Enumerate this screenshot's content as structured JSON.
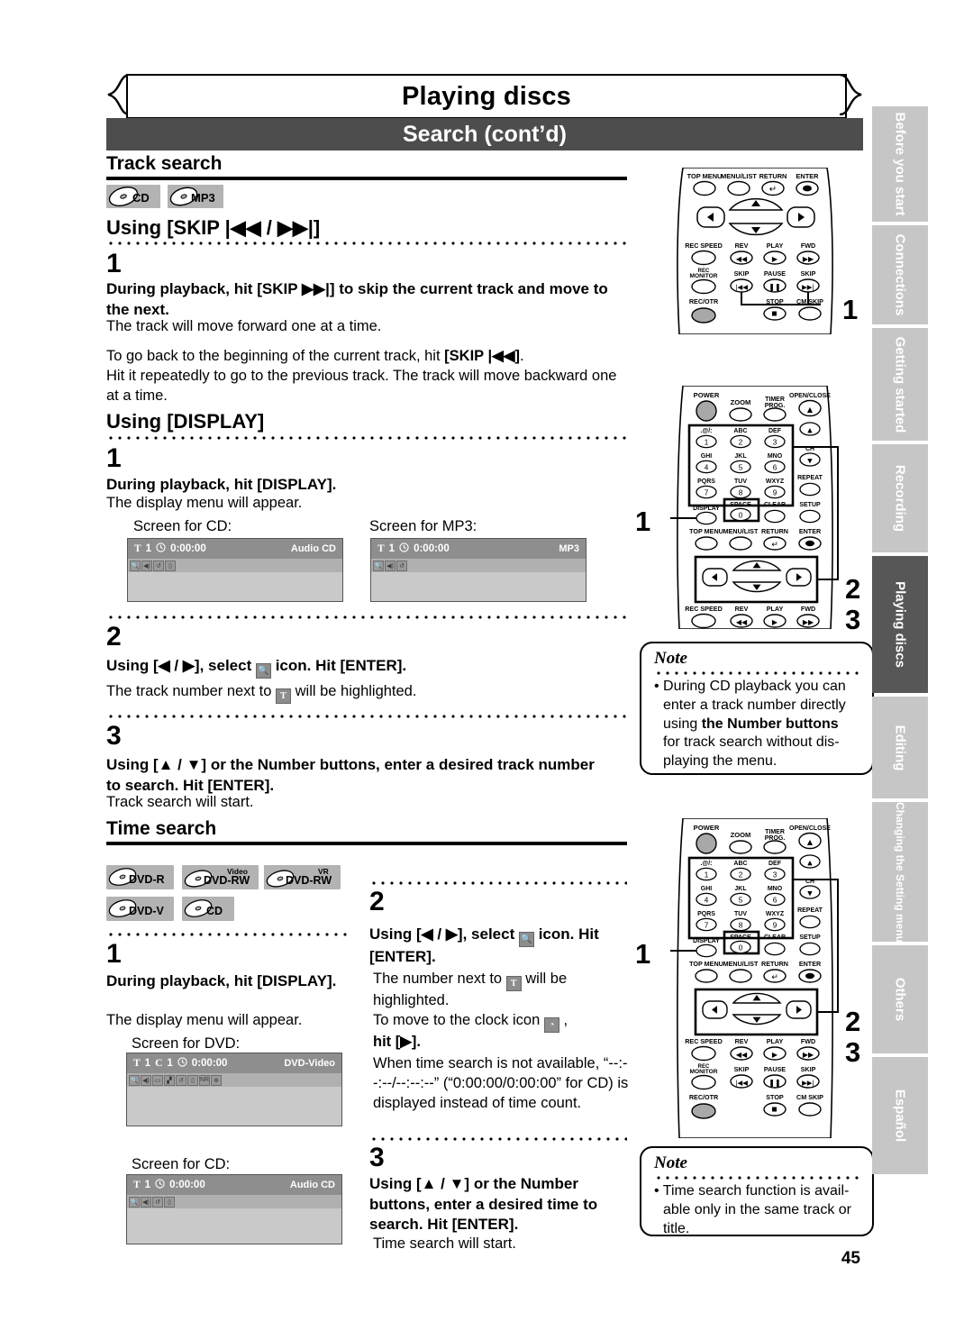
{
  "header": {
    "title": "Playing discs",
    "subtitle": "Search (cont’d)"
  },
  "page_number": "45",
  "sections": {
    "track_search": {
      "heading": "Track search",
      "badges": [
        "CD",
        "MP3"
      ],
      "skip_sub": "Using [SKIP |◀◀ / ▶▶|]",
      "skip_step1_num": "1",
      "skip_step1_bold": "During playback, hit [SKIP ▶▶|] to skip the current track and move to the next.",
      "skip_step1_text": "The track will move forward one at a time.",
      "skip_step1_text2a": "To go back to the beginning of the current track, hit ",
      "skip_step1_text2b": "[SKIP |◀◀]",
      "skip_step1_text2c": ".",
      "skip_step1_text3": "Hit it repeatedly to go to the previous track. The track will move backward one at a time.",
      "display_sub": "Using [DISPLAY]",
      "d_step1_num": "1",
      "d_step1_bold": "During playback, hit [DISPLAY].",
      "d_step1_text": "The display menu will appear.",
      "screen_cd_label": "Screen for CD:",
      "screen_mp3_label": "Screen for MP3:",
      "d_step2_num": "2",
      "d_step2_bold_a": "Using [◀ / ▶], select",
      "d_step2_bold_b": "icon. Hit [ENTER].",
      "d_step2_text_a": "The track number next to",
      "d_step2_text_b": "will be highlighted.",
      "d_step3_num": "3",
      "d_step3_bold": "Using [▲ / ▼] or the Number buttons, enter a desired track number to search. Hit [ENTER].",
      "d_step3_text": "Track search will start."
    },
    "time_search": {
      "heading": "Time search",
      "badges": [
        "DVD-R",
        "DVD-RW",
        "DVD-RW",
        "DVD-V",
        "CD"
      ],
      "badge_tags": [
        "",
        "Video",
        "VR",
        "",
        ""
      ],
      "step1_num": "1",
      "step1_bold": "During playback, hit [DISPLAY].",
      "step1_text": "The display menu will appear.",
      "screen_dvd_label": "Screen for DVD:",
      "screen_cd_label": "Screen for CD:",
      "step2_num": "2",
      "step2_bold_a": "Using [◀ / ▶], select",
      "step2_bold_b": "icon. Hit [ENTER].",
      "step2_t1a": "The number next to",
      "step2_t1b": "will be",
      "step2_t1c": "highlighted.",
      "step2_t2a": "To move to the clock icon",
      "step2_t2b": ",",
      "step2_t2c": "hit [▶].",
      "step2_t3": "When time search is not available, “--:--:--/--:--:--” (“0:00:00/0:00:00” for CD) is displayed instead of time count.",
      "step3_num": "3",
      "step3_bold": "Using [▲ / ▼] or the Number buttons, enter a desired time to search. Hit [ENTER].",
      "step3_text": "Time search will start."
    }
  },
  "osd_screens": {
    "cd_top": {
      "title_glyph": "T",
      "title_num": "1",
      "clock_glyph": "clock-icon",
      "time": "0:00:00",
      "disc_label": "Audio CD",
      "icon_count": 4
    },
    "mp3_top": {
      "title_glyph": "T",
      "title_num": "1",
      "clock_glyph": "clock-icon",
      "time": "0:00:00",
      "disc_label": "MP3",
      "icon_count": 3
    },
    "dvd": {
      "title_glyph": "T",
      "title_num": "1",
      "chapter_glyph": "C",
      "chapter_num": "1",
      "clock_glyph": "clock-icon",
      "time": "0:00:00",
      "disc_label": "DVD-Video",
      "icon_count": 8
    },
    "cd_bottom": {
      "title_glyph": "T",
      "title_num": "1",
      "clock_glyph": "clock-icon",
      "time": "0:00:00",
      "disc_label": "Audio CD",
      "icon_count": 4
    }
  },
  "notes": [
    {
      "title": "Note",
      "bullet_lines": [
        "• During CD playback you can",
        "enter a track number directly",
        "using the Number buttons",
        "for track search without dis-",
        "playing the menu."
      ],
      "bold_fragment": "the Number buttons"
    },
    {
      "title": "Note",
      "bullet_lines": [
        "• Time search function is avail-",
        "able only in the same track or",
        "title."
      ]
    }
  ],
  "remote_top": {
    "labels": {
      "top_menu": "TOP MENU",
      "menu_list": "MENU/LIST",
      "return": "RETURN",
      "enter": "ENTER",
      "rec_speed": "REC SPEED",
      "rev": "REV",
      "play": "PLAY",
      "fwd": "FWD",
      "rec_monitor": "REC MONITOR",
      "skip_back": "SKIP",
      "pause": "PAUSE",
      "skip_fwd": "SKIP",
      "rec_otr": "REC/OTR",
      "stop": "STOP",
      "cm_skip": "CM SKIP"
    },
    "callouts": [
      "1"
    ]
  },
  "remote_mid": {
    "labels": {
      "power": "POWER",
      "zoom": "ZOOM",
      "timer_prog": "TIMER PROG.",
      "open_close": "OPEN/CLOSE",
      "ch": "CH",
      "repeat": "REPEAT",
      "display": "DISPLAY",
      "space": "SPACE",
      "clear": "CLEAR",
      "setup": "SETUP",
      "top_menu": "TOP MENU",
      "menu_list": "MENU/LIST",
      "return": "RETURN",
      "enter": "ENTER",
      "rec_speed": "REC SPEED",
      "rev": "REV",
      "play": "PLAY",
      "fwd": "FWD"
    },
    "keypad": [
      {
        "sub": ".@/:",
        "num": "1"
      },
      {
        "sub": "ABC",
        "num": "2"
      },
      {
        "sub": "DEF",
        "num": "3"
      },
      {
        "sub": "GHI",
        "num": "4"
      },
      {
        "sub": "JKL",
        "num": "5"
      },
      {
        "sub": "MNO",
        "num": "6"
      },
      {
        "sub": "PQRS",
        "num": "7"
      },
      {
        "sub": "TUV",
        "num": "8"
      },
      {
        "sub": "WXYZ",
        "num": "9"
      },
      {
        "sub": "SPACE",
        "num": "0"
      }
    ],
    "callouts": [
      "1",
      "2",
      "3"
    ]
  },
  "remote_bottom": {
    "labels": {
      "power": "POWER",
      "zoom": "ZOOM",
      "timer_prog": "TIMER PROG.",
      "open_close": "OPEN/CLOSE",
      "ch": "CH",
      "repeat": "REPEAT",
      "display": "DISPLAY",
      "space": "SPACE",
      "clear": "CLEAR",
      "setup": "SETUP",
      "top_menu": "TOP MENU",
      "menu_list": "MENU/LIST",
      "return": "RETURN",
      "enter": "ENTER",
      "rec_speed": "REC SPEED",
      "rev": "REV",
      "play": "PLAY",
      "fwd": "FWD",
      "rec_monitor": "REC MONITOR",
      "skip_back": "SKIP",
      "pause": "PAUSE",
      "skip_fwd": "SKIP",
      "rec_otr": "REC/OTR",
      "stop": "STOP",
      "cm_skip": "CM SKIP"
    },
    "callouts": [
      "1",
      "2",
      "3"
    ]
  },
  "sidebar": {
    "tabs": [
      {
        "label": "Before you start",
        "active": false
      },
      {
        "label": "Connections",
        "active": false
      },
      {
        "label": "Getting started",
        "active": false
      },
      {
        "label": "Recording",
        "active": false
      },
      {
        "label": "Playing discs",
        "active": true
      },
      {
        "label": "Editing",
        "active": false
      },
      {
        "label": "Changing the Setting menu",
        "active": false
      },
      {
        "label": "Others",
        "active": false
      },
      {
        "label": "Español",
        "active": false
      }
    ]
  },
  "colors": {
    "subbar_bg": "#4d4d4d",
    "tab_bg": "#c6c6c6",
    "tab_active_bg": "#575757",
    "badge_bg": "#b3b3b3",
    "osd_header": "#8e8e8e",
    "osd_body": "#c9c9c9"
  }
}
